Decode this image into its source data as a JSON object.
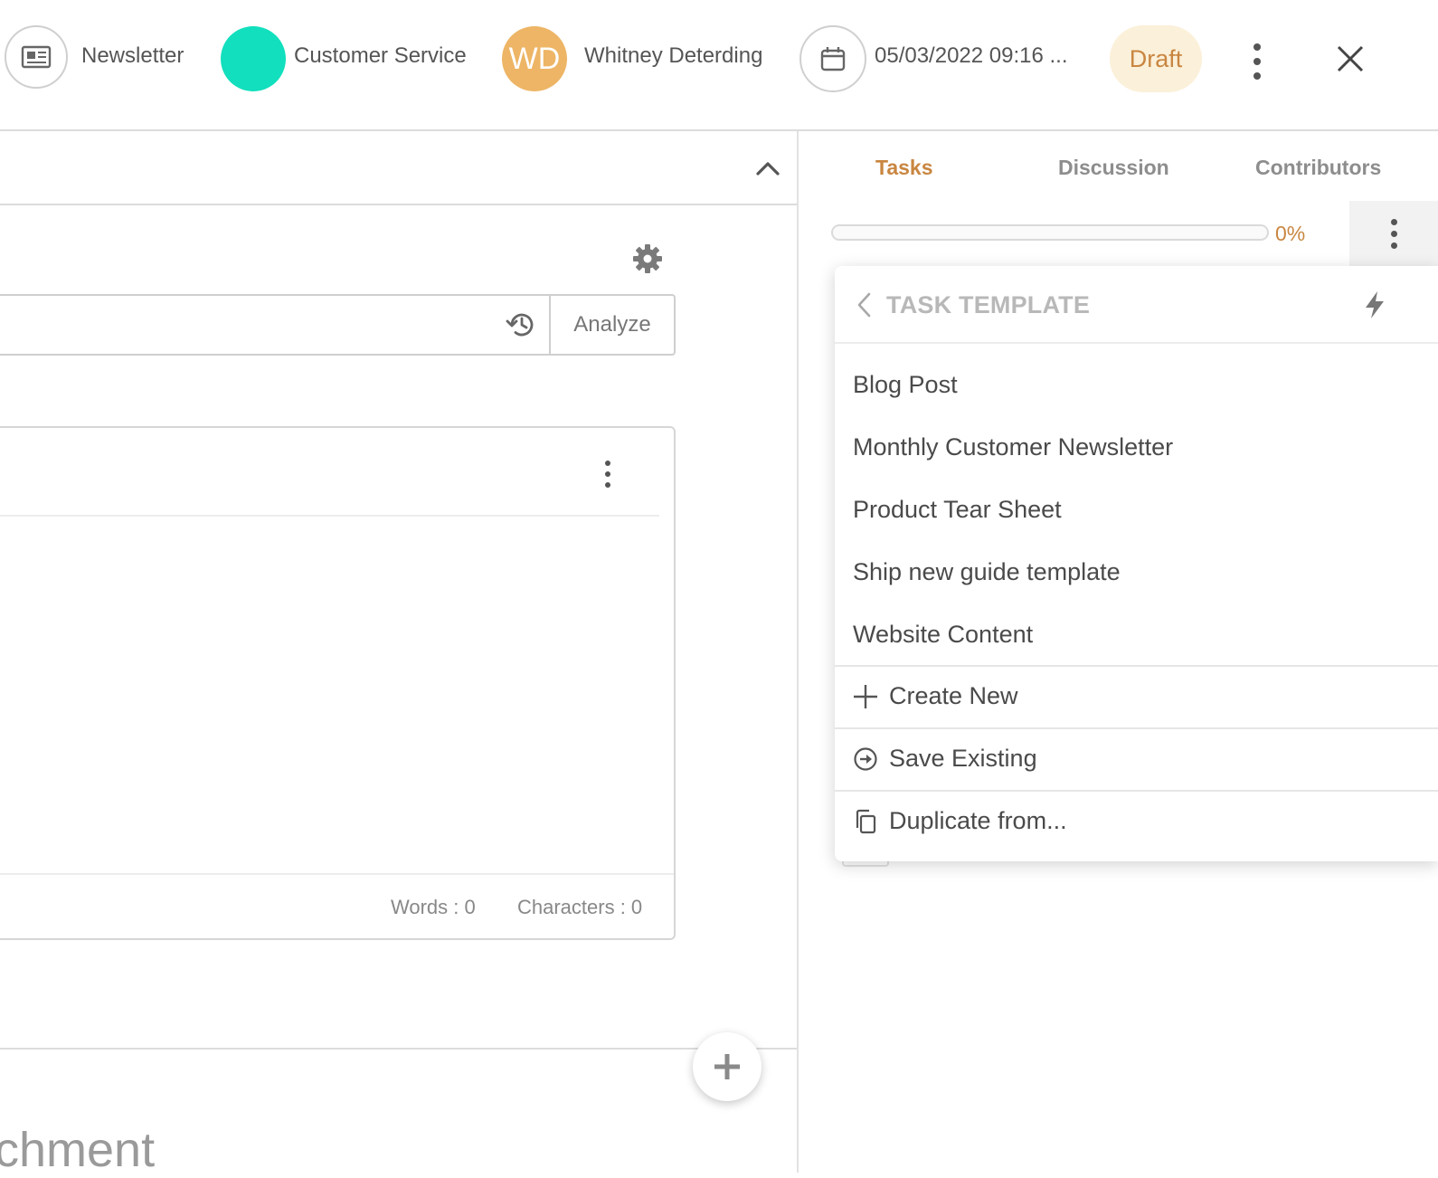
{
  "header": {
    "type_label": "Newsletter",
    "team_label": "Customer Service",
    "assignee_initials": "WD",
    "assignee_name": "Whitney Deterding",
    "date_label": "05/03/2022 09:16 ...",
    "status_badge": "Draft"
  },
  "editor": {
    "analyze_label": "Analyze",
    "words_label": "Words : 0",
    "characters_label": "Characters : 0",
    "section_text_cut": "chment"
  },
  "tabs": [
    {
      "label": "Tasks",
      "active": true
    },
    {
      "label": "Discussion",
      "active": false
    },
    {
      "label": "Contributors",
      "active": false
    }
  ],
  "progress": {
    "value": 0,
    "label": "0%"
  },
  "task_template_menu": {
    "title": "TASK TEMPLATE",
    "templates": [
      "Blog Post",
      "Monthly Customer Newsletter",
      "Product Tear Sheet",
      "Ship new guide template",
      "Website Content"
    ],
    "actions": {
      "create_new": "Create New",
      "save_existing": "Save Existing",
      "duplicate_from": "Duplicate from..."
    }
  },
  "colors": {
    "accent": "#c98641",
    "teal_avatar": "#12dfbd",
    "wd_avatar": "#edb565",
    "draft_bg": "#fbf0d9"
  },
  "icons": [
    "newspaper-icon",
    "calendar-icon",
    "more-vertical-icon",
    "close-icon",
    "chevron-up-icon",
    "gear-icon",
    "history-icon",
    "chevron-left-icon",
    "lightning-icon",
    "plus-icon",
    "arrow-circle-right-icon",
    "copy-icon"
  ]
}
